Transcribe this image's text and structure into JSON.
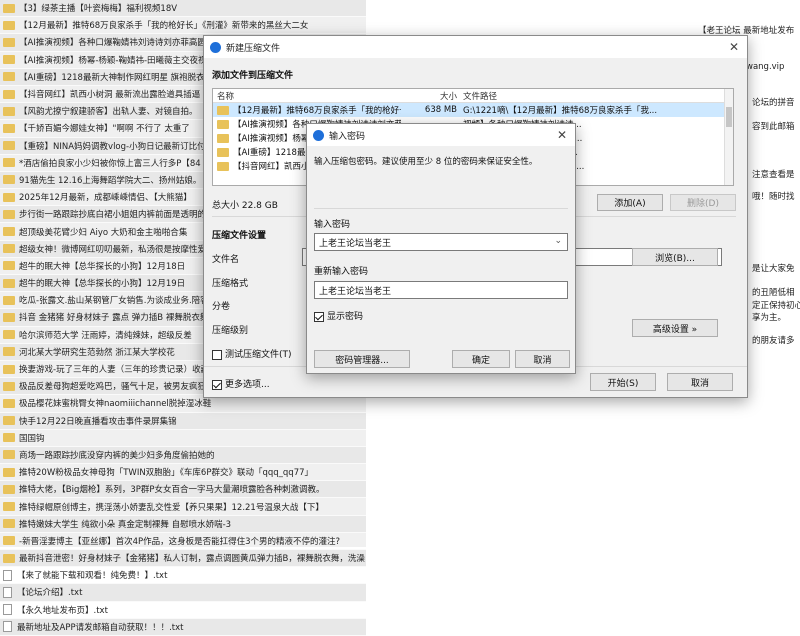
{
  "background_list": [
    {
      "icon": "folder",
      "text": "【3】绿茶主播【叶瓷梅梅】福利视频18V"
    },
    {
      "icon": "folder",
      "text": "【12月最新】推特68万良家杀手「我的枪好长」《刑灌》新带来的黑丝大二女"
    },
    {
      "icon": "folder",
      "text": "【AI推演视频】各种口爆鞠婧祎刘诗诗刘亦菲高圆圆淑"
    },
    {
      "icon": "folder",
      "text": "【AI推演视频】杨幂-杨颖-鞠婧祎-田曦薇主交夜视"
    },
    {
      "icon": "folder",
      "text": "【AI重磅】1218最新大神制作网红明星 旗袍脱衣"
    },
    {
      "icon": "folder",
      "text": "【抖音网红】凯西小树洞 最新流出露脸道具插逼"
    },
    {
      "icon": "folder",
      "text": "【风韵尤撩宁叙建骄客】出轨人妻、对镜自拍。"
    },
    {
      "icon": "folder",
      "text": "【千娇百媚今娜娃女神】\"啊啊 不行了 太重了"
    },
    {
      "icon": "folder",
      "text": "【重磅】NINA妈妈调教vlog-小狗日记最新订比付"
    },
    {
      "icon": "folder",
      "text": "*酒店偷拍良家小少妇被你惊上富三人行多P【84"
    },
    {
      "icon": "folder",
      "text": "91猫先生 12.16上海舞蹈学院大二、扬州姑娘。"
    },
    {
      "icon": "folder",
      "text": "2025年12月最新，成都嵊嵊情侣、【大熊猫】"
    },
    {
      "icon": "folder",
      "text": "步行街一路跟踪抄底白裙小姐姐内裤前面是透明的"
    },
    {
      "icon": "folder",
      "text": "超顶级美花臂少妇 Aiyo 大奶和金主啪啪合集"
    },
    {
      "icon": "folder",
      "text": "超级女神！微博网红叨叨最新，私汤很是按摩性爱"
    },
    {
      "icon": "folder",
      "text": "超牛的眠大神【总华探长的小狗】12月18日"
    },
    {
      "icon": "folder",
      "text": "超牛的眠大神【总华探长的小狗】12月19日"
    },
    {
      "icon": "folder",
      "text": "吃瓜-张露文.盐山某钢管厂女销售.为谈成业务.陪客"
    },
    {
      "icon": "folder",
      "text": "抖音 金猪猪 好身材妹子 露点 弹力插B 裸舞脱衣舞"
    },
    {
      "icon": "folder",
      "text": "哈尔滨师范大学 汪雨婷，清纯辣妹，超级反差"
    },
    {
      "icon": "folder",
      "text": "河北某大学研究生范勃然 浙江某大学校花"
    },
    {
      "icon": "folder",
      "text": "换妻游戏-玩了三年的人妻（三年的珍贵记录）收藏"
    },
    {
      "icon": "folder",
      "text": "极品反差母狗超爱吃鸡巴，骚气十足，被男友疯狂抽"
    },
    {
      "icon": "folder",
      "text": "极品樱花妹蜜桃臀女神naomiiichannel脱掉湿冰鞋"
    },
    {
      "icon": "folder",
      "text": "快手12月22日晚直播看攻击事件录屏集锦"
    },
    {
      "icon": "folder",
      "text": "国国钩"
    },
    {
      "icon": "folder",
      "text": "商场一路跟踪抄底没穿内裤的美少妇多角度偷拍她的"
    },
    {
      "icon": "folder",
      "text": "推特20W粉极品女神母狗「TWIN双胞胎」《车库6P群交》联动「qqq_qq77」"
    },
    {
      "icon": "folder",
      "text": "推特大佬，【Big烟枪】系列，3P群P女女百合一字马大量潮喷露脸各种刺激调教。"
    },
    {
      "icon": "folder",
      "text": "推特绿帽原创博主，携淫荡小娇妻乱交性爱【养只果果】12.21号温泉大战【下】"
    },
    {
      "icon": "folder",
      "text": "推特嫩妹大学生 纯欲小朵 真金定制裸舞 自慰喷水娇喘-3"
    },
    {
      "icon": "folder",
      "text": "-新晋淫妻博主【亚丝娜】首次4P作品，这身板是否能扛得住3个男的精液不停的灌注?"
    },
    {
      "icon": "folder",
      "text": "最新抖音泄密！好身材妹子【金猪猪】私人订制，露点调圆黄瓜弹力插B，裸舞脱衣舞，洗澡"
    },
    {
      "icon": "txt",
      "text": "【来了就能下载和观看！纯免费！】.txt"
    },
    {
      "icon": "txt",
      "text": "【论坛介绍】.txt"
    },
    {
      "icon": "txt",
      "text": "【永久地址发布页】.txt"
    },
    {
      "icon": "txt",
      "text": "最新地址及APP请发邮箱自动获取！！！.txt"
    }
  ],
  "right_doc": {
    "line1": "【老王论坛 最新地址发布",
    "line2": "wang.vip",
    "line3": "论坛的拼音",
    "line4": "容到此邮箱",
    "line5": "注意查看是",
    "line6": "哦！随时找",
    "line7": "是让大家免",
    "line8": "的丑陋低相",
    "line9": "定正保持初心",
    "line10": "享为主。",
    "line11": "的朋友请多"
  },
  "archive_dialog": {
    "title": "新建压缩文件",
    "section_add": "添加文件到压缩文件",
    "columns": {
      "name": "名称",
      "size": "大小",
      "path": "文件路径"
    },
    "files": [
      {
        "name": "【12月最新】推特68万良家杀手「我的枪好长」...",
        "size": "638 MB",
        "path": "G:\\1221嘀\\【12月最新】推特68万良家杀手「我..."
      },
      {
        "name": "【AI推演视频】各种口爆鞠婧祎刘诗诗刘亦菲高圆圆淑",
        "size": "",
        "path": "视频】各种口爆鞠婧祎刘诗诗..."
      },
      {
        "name": "【AI推演视频】杨幂-杨颖-鞠婧祎-田曦薇主交夜视",
        "size": "",
        "path": "视频】杨幂-杨颖-鞠婧祎-田曦..."
      },
      {
        "name": "【AI重磅】1218最新大神制作网红明星 旗袍脱衣",
        "size": "",
        "path": "】1218最新大神制作网红明..."
      },
      {
        "name": "【抖音网红】凯西小树洞 最新流出露脸道具插逼",
        "size": "",
        "path": "红】凯西小树洞 最新流出露脸..."
      }
    ],
    "total_size": "总大小 22.8 GB",
    "add_button": "添加(A)",
    "delete_button": "删除(D)",
    "section_settings": "压缩文件设置",
    "filename_label": "文件名",
    "format_label": "压缩格式",
    "split_label": "分卷",
    "level_label": "压缩级别",
    "browse_button": "浏览(B)...",
    "test_label": "测试压缩文件(T)",
    "advanced_button": "高级设置 »",
    "more_options": "更多选项...",
    "start_button": "开始(S)",
    "cancel_button": "取消"
  },
  "password_dialog": {
    "title": "输入密码",
    "instruction": "输入压缩包密码。建议使用至少 8 位的密码来保证安全性。",
    "password_label": "输入密码",
    "password_value": "上老王论坛当老王",
    "confirm_label": "重新输入密码",
    "confirm_value": "上老王论坛当老王",
    "show_password": "显示密码",
    "manager_button": "密码管理器...",
    "ok_button": "确定",
    "cancel_button": "取消"
  }
}
